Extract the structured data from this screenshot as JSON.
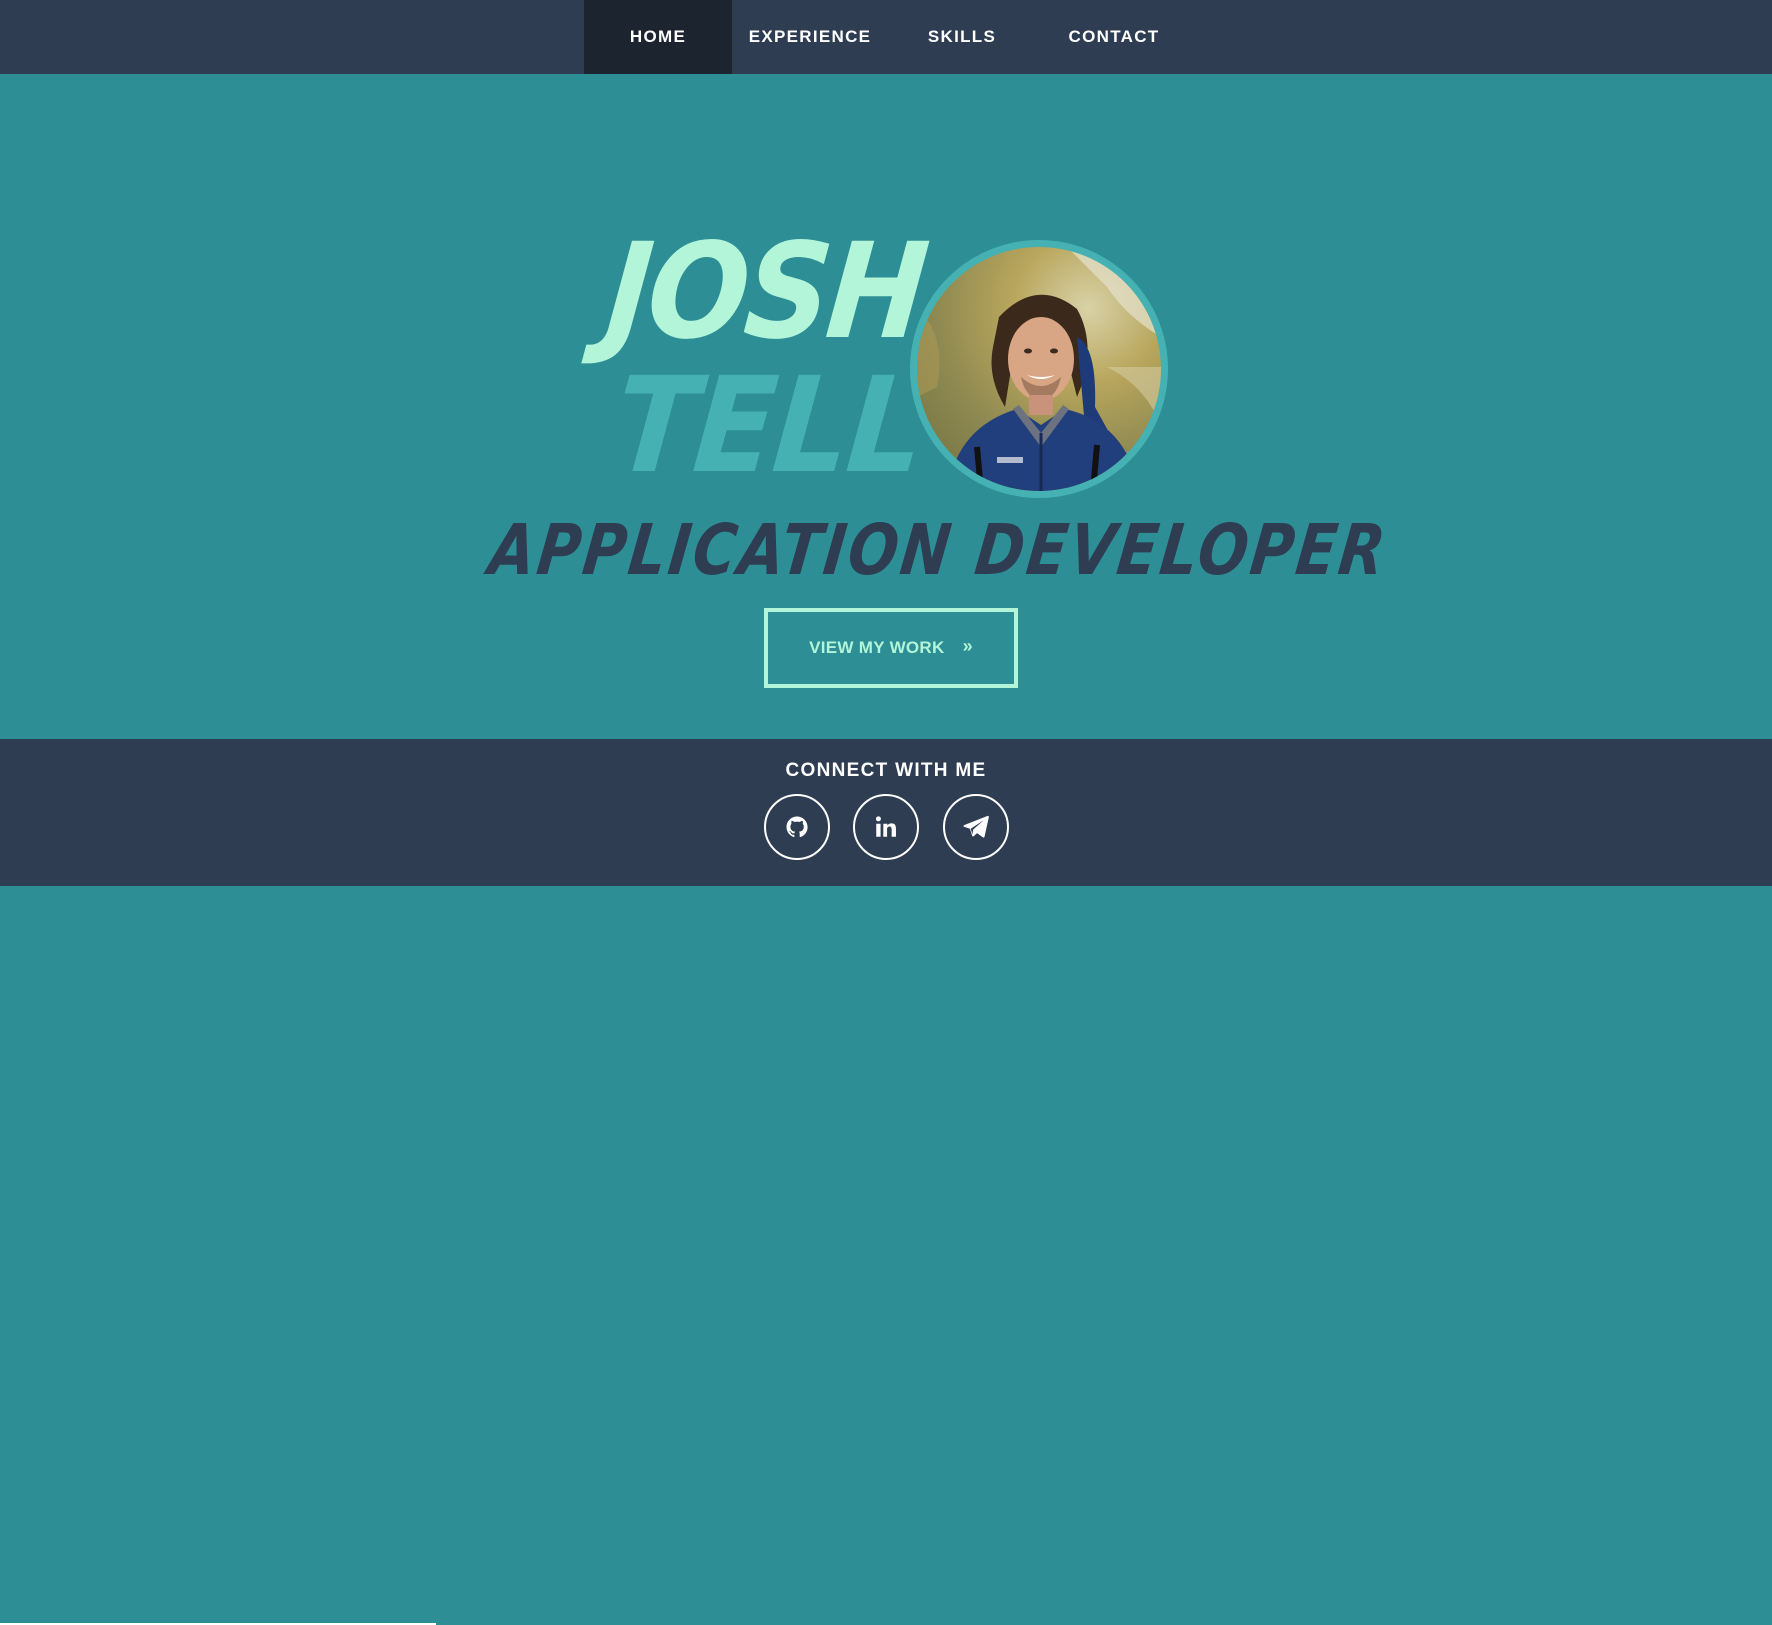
{
  "nav": {
    "items": [
      {
        "label": "HOME",
        "active": true
      },
      {
        "label": "EXPERIENCE",
        "active": false
      },
      {
        "label": "SKILLS",
        "active": false
      },
      {
        "label": "CONTACT",
        "active": false
      }
    ]
  },
  "hero": {
    "first_name": "JOSH",
    "last_name": "TELL",
    "title": "APPLICATION DEVELOPER",
    "cta_label": "VIEW MY WORK",
    "cta_icon": "double-chevron-right-icon",
    "avatar_icon": "profile-photo"
  },
  "footer": {
    "title": "CONNECT WITH ME",
    "social": [
      {
        "icon": "github-icon"
      },
      {
        "icon": "linkedin-icon"
      },
      {
        "icon": "telegram-icon"
      }
    ]
  },
  "colors": {
    "nav_bg": "#2e3d51",
    "nav_active_bg": "#1c2430",
    "hero_bg": "#2d8e95",
    "accent_mint": "#b2f5d9",
    "accent_teal": "#45b1b2",
    "dark_text": "#2e3d51"
  }
}
